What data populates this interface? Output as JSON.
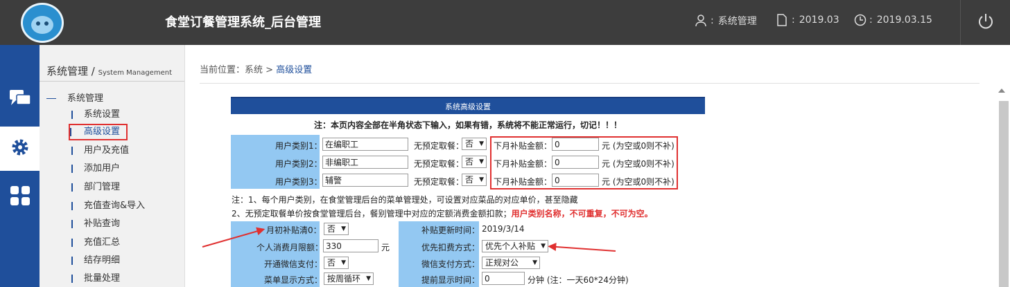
{
  "header": {
    "app_title": "食堂订餐管理系统_后台管理",
    "user_sep": ":",
    "user": "系统管理",
    "version_sep": ":",
    "version": "2019.03",
    "date_sep": ":",
    "date": "2019.03.15",
    "icons": [
      "user-icon",
      "document-icon",
      "clock-icon",
      "power-icon"
    ]
  },
  "leftnav": {
    "icons": [
      "chat-icon",
      "gear-icon",
      "grid-icon"
    ]
  },
  "sidebar": {
    "title": "系统管理",
    "title_sep": "/",
    "subtitle": "System Management",
    "group": "系统管理",
    "items": [
      {
        "label": "系统设置"
      },
      {
        "label": "高级设置"
      },
      {
        "label": "用户及充值"
      },
      {
        "label": "添加用户"
      },
      {
        "label": "部门管理"
      },
      {
        "label": "充值查询&导入"
      },
      {
        "label": "补贴查询"
      },
      {
        "label": "充值汇总"
      },
      {
        "label": "结存明细"
      },
      {
        "label": "批量处理"
      }
    ]
  },
  "breadcrumb": {
    "prefix": "当前位置：系统",
    "sep": ">",
    "current": "高级设置"
  },
  "panel": {
    "title": "系统高级设置",
    "warning": "注：本页内容全部在半角状态下输入，如果有错，系统将不能正常运行，切记！！！",
    "user_types": [
      {
        "label": "用户类别1：",
        "value": "在编职工",
        "noshow_label": "无预定取餐：",
        "noshow_value": "否",
        "subsidy_label": "下月补贴金额：",
        "subsidy_value": "0",
        "subsidy_hint": "元 (为空或0则不补)"
      },
      {
        "label": "用户类别2：",
        "value": "非编职工",
        "noshow_label": "无预定取餐：",
        "noshow_value": "否",
        "subsidy_label": "下月补贴金额：",
        "subsidy_value": "0",
        "subsidy_hint": "元 (为空或0则不补)"
      },
      {
        "label": "用户类别3：",
        "value": "辅警",
        "noshow_label": "无预定取餐：",
        "noshow_value": "否",
        "subsidy_label": "下月补贴金额：",
        "subsidy_value": "0",
        "subsidy_hint": "元 (为空或0则不补)"
      }
    ],
    "note1": "注：1、每个用户类别，在食堂管理后台的菜单管理处，可设置对应菜品的对应单价，甚至隐藏",
    "note2": "2、无预定取餐单价按食堂管理后台，餐别管理中对应的定额消费金额扣款；",
    "note2_red": "用户类别名称，不可重复，不可为空。",
    "settings_left": [
      {
        "label": "月初补贴清0：",
        "value": "否"
      },
      {
        "label": "个人消费月限额：",
        "value": "330",
        "unit": "元"
      },
      {
        "label": "开通微信支付：",
        "value": "否"
      },
      {
        "label": "菜单显示方式：",
        "value": "按周循环"
      }
    ],
    "settings_right": [
      {
        "label": "补贴更新时间：",
        "value": "2019/3/14"
      },
      {
        "label": "优先扣费方式：",
        "value": "优先个人补贴"
      },
      {
        "label": "微信支付方式：",
        "value": "正规对公"
      },
      {
        "label": "提前显示时间：",
        "value": "0",
        "unit": "分钟 (注：一天60*24分钟)"
      }
    ]
  },
  "colors": {
    "topbar": "#3d3d3d",
    "nav": "#1f4f9b",
    "label_bg": "#93c8f2",
    "highlight": "#e03030"
  }
}
